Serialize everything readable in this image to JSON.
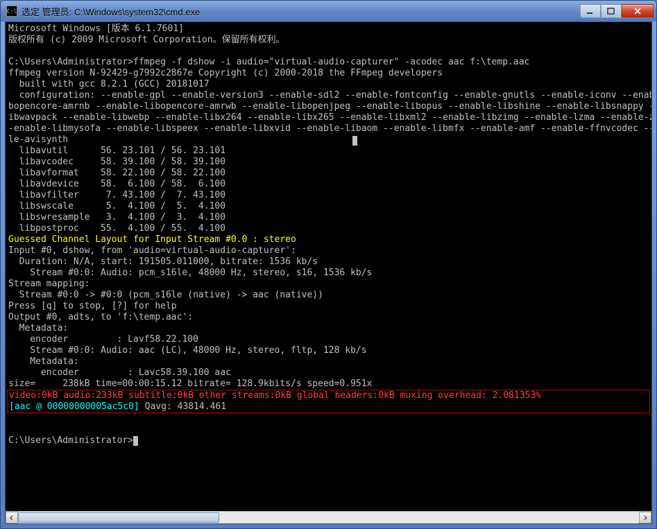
{
  "window": {
    "title": "选定 管理员: C:\\Windows\\system32\\cmd.exe"
  },
  "term": {
    "l01": "Microsoft Windows [版本 6.1.7601]",
    "l02": "版权所有 (c) 2009 Microsoft Corporation。保留所有权利。",
    "l03": "",
    "l04": "C:\\Users\\Administrator>ffmpeg -f dshow -i audio=\"virtual-audio-capturer\" -acodec aac f:\\temp.aac",
    "l05": "ffmpeg version N-92429-g7992c2867e Copyright (c) 2000-2018 the FFmpeg developers",
    "l06": "  built with gcc 8.2.1 (GCC) 20181017",
    "l07": "  configuration: --enable-gpl --enable-version3 --enable-sdl2 --enable-fontconfig --enable-gnutls --enable-iconv --enable-libass --",
    "l08": "bopencore-amrnb --enable-libopencore-amrwb --enable-libopenjpeg --enable-libopus --enable-libshine --enable-libsnappy --enable-lib",
    "l09": "ibwavpack --enable-libwebp --enable-libx264 --enable-libx265 --enable-libxml2 --enable-libzimg --enable-lzma --enable-zlib --enabl",
    "l10": "-enable-libmysofa --enable-libspeex --enable-libxvid --enable-libaom --enable-libmfx --enable-amf --enable-ffnvcodec --enable-cuvi",
    "l11": "le-avisynth",
    "l12": "  libavutil      56. 23.101 / 56. 23.101",
    "l13": "  libavcodec     58. 39.100 / 58. 39.100",
    "l14": "  libavformat    58. 22.100 / 58. 22.100",
    "l15": "  libavdevice    58.  6.100 / 58.  6.100",
    "l16": "  libavfilter     7. 43.100 /  7. 43.100",
    "l17": "  libswscale      5.  4.100 /  5.  4.100",
    "l18": "  libswresample   3.  4.100 /  3.  4.100",
    "l19": "  libpostproc    55.  4.100 / 55.  4.100",
    "l20": "Guessed Channel Layout for Input Stream #0.0 : stereo",
    "l21": "Input #0, dshow, from 'audio=virtual-audio-capturer':",
    "l22": "  Duration: N/A, start: 191505.011000, bitrate: 1536 kb/s",
    "l23": "    Stream #0:0: Audio: pcm_s16le, 48000 Hz, stereo, s16, 1536 kb/s",
    "l24": "Stream mapping:",
    "l25": "  Stream #0:0 -> #0:0 (pcm_s16le (native) -> aac (native))",
    "l26": "Press [q] to stop, [?] for help",
    "l27": "Output #0, adts, to 'f:\\temp.aac':",
    "l28": "  Metadata:",
    "l29": "    encoder         : Lavf58.22.100",
    "l30": "    Stream #0:0: Audio: aac (LC), 48000 Hz, stereo, fltp, 128 kb/s",
    "l31": "    Metadata:",
    "l32": "      encoder         : Lavc58.39.100 aac",
    "l33": "size=     238kB time=00:00:15.12 bitrate= 128.9kbits/s speed=0.951x",
    "l34": "video:0kB audio:233kB subtitle:0kB other streams:0kB global headers:0kB muxing overhead: 2.081353%",
    "l35a": "[aac @ 00000000005ac5c0]",
    "l35b": " Qavg: 43814.461",
    "l36": "",
    "l37": "C:\\Users\\Administrator>"
  }
}
